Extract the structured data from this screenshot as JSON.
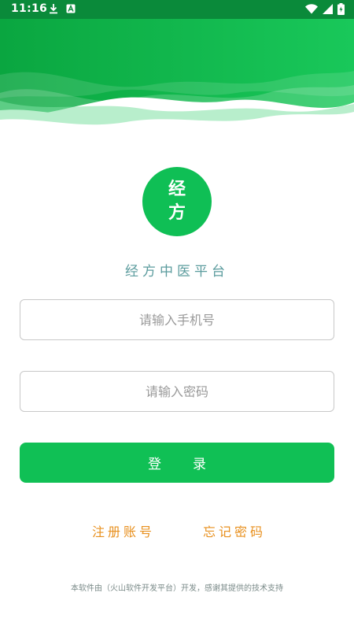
{
  "status_bar": {
    "time": "11:16",
    "left_icons": [
      "download-icon",
      "a-notification-icon"
    ],
    "right_icons": [
      "wifi-icon",
      "signal-icon",
      "battery-charging-icon"
    ]
  },
  "logo": {
    "line1": "经",
    "line2": "方"
  },
  "app_name": "经方中医平台",
  "phone_input": {
    "placeholder": "请输入手机号",
    "value": ""
  },
  "password_input": {
    "placeholder": "请输入密码",
    "value": ""
  },
  "login_button": {
    "label": "登录"
  },
  "links": {
    "register": "注册账号",
    "forgot_password": "忘记密码"
  },
  "footer": "本软件由（火山软件开发平台）开发，感谢其提供的技术支持",
  "colors": {
    "primary_green": "#10c055",
    "status_bar": "#0a8a3a",
    "app_name_text": "#5c9c9e",
    "link_orange": "#e8901e",
    "input_border": "#c8c8c8",
    "placeholder": "#9a9a9a"
  }
}
